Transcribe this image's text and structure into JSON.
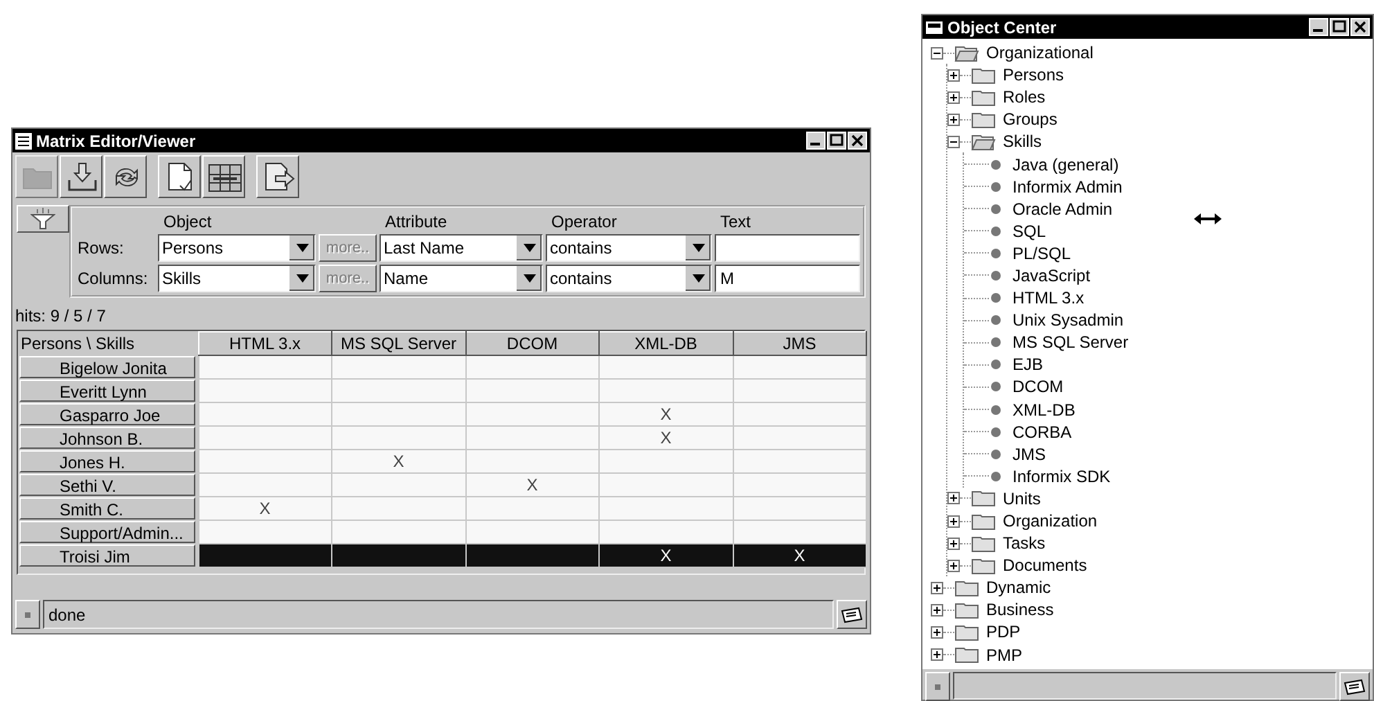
{
  "matrix_window": {
    "title": "Matrix Editor/Viewer",
    "toolbar": [
      [
        {
          "kind": "folder",
          "disabled": true
        },
        {
          "kind": "import",
          "disabled": false
        },
        {
          "kind": "refresh",
          "disabled": false
        }
      ],
      [
        {
          "kind": "document",
          "disabled": false
        },
        {
          "kind": "grid",
          "disabled": false
        }
      ],
      [
        {
          "kind": "export",
          "disabled": false
        }
      ]
    ],
    "filter": {
      "headers": [
        "Object",
        "Attribute",
        "Operator",
        "Text"
      ],
      "rows": [
        {
          "label": "Rows:",
          "object": "Persons",
          "more": "more..",
          "more_disabled": true,
          "attribute": "Last Name",
          "operator": "contains"
        },
        {
          "label": "Columns:",
          "object": "Skills",
          "more": "more..",
          "more_disabled": true,
          "attribute": "Name",
          "operator": "contains",
          "text": "M"
        }
      ]
    },
    "hits": "hits: 9 / 5 / 7",
    "table": {
      "corner": "Persons \\ Skills",
      "columns": [
        "HTML 3.x",
        "MS SQL Server",
        "DCOM",
        "XML-DB",
        "JMS"
      ],
      "rows": [
        {
          "name": "Bigelow Jonita",
          "cells": [
            "",
            "",
            "",
            "",
            ""
          ],
          "selected": false
        },
        {
          "name": "Everitt Lynn",
          "cells": [
            "",
            "",
            "",
            "",
            ""
          ],
          "selected": false
        },
        {
          "name": "Gasparro Joe",
          "cells": [
            "",
            "",
            "",
            "X",
            ""
          ],
          "selected": false
        },
        {
          "name": "Johnson B.",
          "cells": [
            "",
            "",
            "",
            "X",
            ""
          ],
          "selected": false
        },
        {
          "name": "Jones H.",
          "cells": [
            "",
            "X",
            "",
            "",
            ""
          ],
          "selected": false
        },
        {
          "name": "Sethi V.",
          "cells": [
            "",
            "",
            "X",
            "",
            ""
          ],
          "selected": false
        },
        {
          "name": "Smith C.",
          "cells": [
            "X",
            "",
            "",
            "",
            ""
          ],
          "selected": false
        },
        {
          "name": "Support/Admin...",
          "cells": [
            "",
            "",
            "",
            "",
            ""
          ],
          "selected": false
        },
        {
          "name": "Troisi Jim",
          "cells": [
            "",
            "",
            "",
            "X",
            "X"
          ],
          "selected": true
        }
      ]
    },
    "status": "done"
  },
  "object_center": {
    "title": "Object Center",
    "tree": [
      {
        "label": "Organizational",
        "kind": "folder",
        "expanded": true,
        "children": [
          {
            "label": "Persons",
            "kind": "folder",
            "expanded": false
          },
          {
            "label": "Roles",
            "kind": "folder",
            "expanded": false
          },
          {
            "label": "Groups",
            "kind": "folder",
            "expanded": false
          },
          {
            "label": "Skills",
            "kind": "folder",
            "expanded": true,
            "children": [
              {
                "label": "Java (general)",
                "kind": "leaf"
              },
              {
                "label": "Informix Admin",
                "kind": "leaf"
              },
              {
                "label": "Oracle Admin",
                "kind": "leaf"
              },
              {
                "label": "SQL",
                "kind": "leaf"
              },
              {
                "label": "PL/SQL",
                "kind": "leaf"
              },
              {
                "label": "JavaScript",
                "kind": "leaf"
              },
              {
                "label": "HTML 3.x",
                "kind": "leaf"
              },
              {
                "label": "Unix Sysadmin",
                "kind": "leaf"
              },
              {
                "label": "MS SQL Server",
                "kind": "leaf"
              },
              {
                "label": "EJB",
                "kind": "leaf"
              },
              {
                "label": "DCOM",
                "kind": "leaf"
              },
              {
                "label": "XML-DB",
                "kind": "leaf"
              },
              {
                "label": "CORBA",
                "kind": "leaf"
              },
              {
                "label": "JMS",
                "kind": "leaf"
              },
              {
                "label": "Informix SDK",
                "kind": "leaf"
              }
            ]
          },
          {
            "label": "Units",
            "kind": "folder",
            "expanded": false
          },
          {
            "label": "Organization",
            "kind": "folder",
            "expanded": false
          },
          {
            "label": "Tasks",
            "kind": "folder",
            "expanded": false
          },
          {
            "label": "Documents",
            "kind": "folder",
            "expanded": false
          }
        ]
      },
      {
        "label": "Dynamic",
        "kind": "folder",
        "expanded": false
      },
      {
        "label": "Business",
        "kind": "folder",
        "expanded": false
      },
      {
        "label": "PDP",
        "kind": "folder",
        "expanded": false
      },
      {
        "label": "PMP",
        "kind": "folder",
        "expanded": false
      }
    ]
  }
}
